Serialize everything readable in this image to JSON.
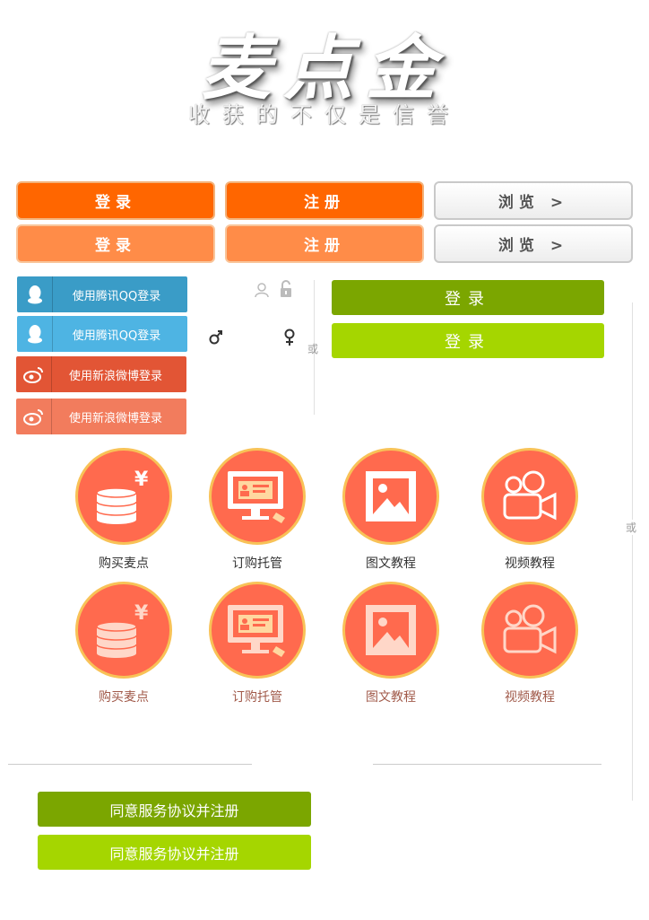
{
  "logo": {
    "title": "麦点金",
    "slogan": "收获的不仅是信誉"
  },
  "buttons_row1": {
    "login": "登录",
    "register": "注册",
    "browse": "浏览 >"
  },
  "buttons_row2": {
    "login": "登录",
    "register": "注册",
    "browse": "浏览 >"
  },
  "social": {
    "qq_1": "使用腾讯QQ登录",
    "qq_2": "使用腾讯QQ登录",
    "weibo_1": "使用新浪微博登录",
    "weibo_2": "使用新浪微博登录"
  },
  "divider": {
    "or_left": "或",
    "or_right": "或"
  },
  "green_login": {
    "primary": "登录",
    "secondary": "登录"
  },
  "features_row1": [
    {
      "label": "购买麦点",
      "icon": "coins-yen-icon"
    },
    {
      "label": "订购托管",
      "icon": "monitor-id-card-icon"
    },
    {
      "label": "图文教程",
      "icon": "picture-icon"
    },
    {
      "label": "视频教程",
      "icon": "video-camera-icon"
    }
  ],
  "features_row2": [
    {
      "label": "购买麦点",
      "icon": "coins-yen-icon"
    },
    {
      "label": "订购托管",
      "icon": "monitor-id-card-icon"
    },
    {
      "label": "图文教程",
      "icon": "picture-icon"
    },
    {
      "label": "视频教程",
      "icon": "video-camera-icon"
    }
  ],
  "agree": {
    "primary": "同意服务协议并注册",
    "secondary": "同意服务协议并注册"
  },
  "colors": {
    "orange": "#ff6600",
    "orange_light": "#ff8c48",
    "green": "#7ba600",
    "green_light": "#a5d600",
    "qq": "#3a9cc7",
    "weibo": "#e25535",
    "circle": "#ff6a4e",
    "circle_border": "#f8c257"
  }
}
